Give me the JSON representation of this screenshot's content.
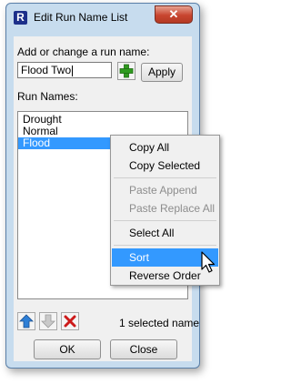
{
  "window": {
    "title": "Edit Run Name List",
    "close_glyph": "✕",
    "app_icon": "R"
  },
  "edit": {
    "label": "Add or change a run name:",
    "value": "Flood Two",
    "apply_label": "Apply",
    "add_icon": "plus-icon"
  },
  "list": {
    "label": "Run Names:",
    "items": [
      {
        "text": "Drought",
        "selected": false
      },
      {
        "text": "Normal",
        "selected": false
      },
      {
        "text": "Flood",
        "selected": true
      }
    ]
  },
  "status": "1 selected name",
  "buttons": {
    "ok": "OK",
    "cancel": "Close"
  },
  "context_menu": {
    "items": [
      {
        "label": "Copy All",
        "enabled": true
      },
      {
        "label": "Copy Selected",
        "enabled": true
      },
      {
        "label": "Paste Append",
        "enabled": false
      },
      {
        "label": "Paste Replace All",
        "enabled": false
      },
      {
        "label": "Select All",
        "enabled": true
      },
      {
        "label": "Sort",
        "enabled": true,
        "highlighted": true
      },
      {
        "label": "Reverse Order",
        "enabled": true
      }
    ]
  },
  "colors": {
    "selection": "#3399ff",
    "window_frame": "#c7dcee",
    "close_button": "#c8452f"
  }
}
